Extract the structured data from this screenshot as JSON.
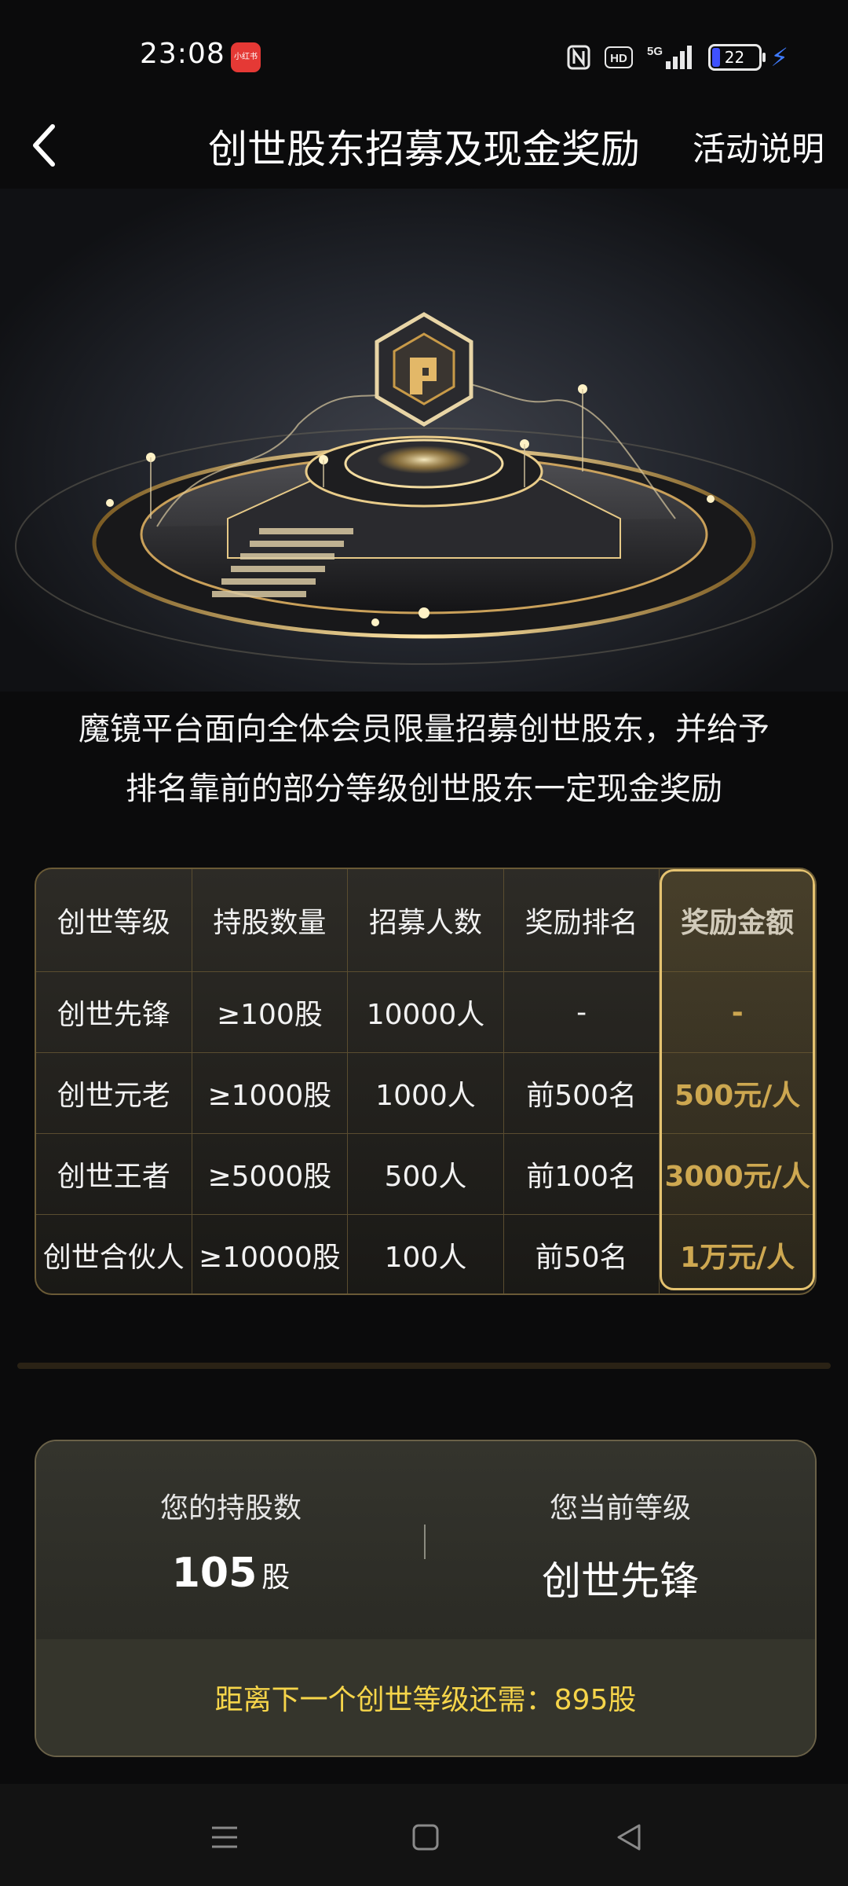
{
  "status_bar": {
    "time": "23:08",
    "app_badge": "小红书",
    "network": "5G",
    "hd": "HD",
    "battery": "22"
  },
  "header": {
    "title": "创世股东招募及现金奖励",
    "info_link": "活动说明"
  },
  "intro": {
    "line1": "魔镜平台面向全体会员限量招募创世股东，并给予",
    "line2": "排名靠前的部分等级创世股东一定现金奖励"
  },
  "table": {
    "headers": [
      "创世等级",
      "持股数量",
      "招募人数",
      "奖励排名",
      "奖励金额"
    ],
    "rows": [
      [
        "创世先锋",
        "≥100股",
        "10000人",
        "-",
        "-"
      ],
      [
        "创世元老",
        "≥1000股",
        "1000人",
        "前500名",
        "500元/人"
      ],
      [
        "创世王者",
        "≥5000股",
        "500人",
        "前100名",
        "3000元/人"
      ],
      [
        "创世合伙人",
        "≥10000股",
        "100人",
        "前50名",
        "1万元/人"
      ]
    ]
  },
  "summary": {
    "holding_label": "您的持股数",
    "holding_value": "105",
    "holding_unit": "股",
    "level_label": "您当前等级",
    "level_value": "创世先锋",
    "next_level_note": "距离下一个创世等级还需：895股"
  },
  "colors": {
    "gold": "#f6c85f",
    "note_yellow": "#f6d54a",
    "bg": "#0b0b0c"
  }
}
